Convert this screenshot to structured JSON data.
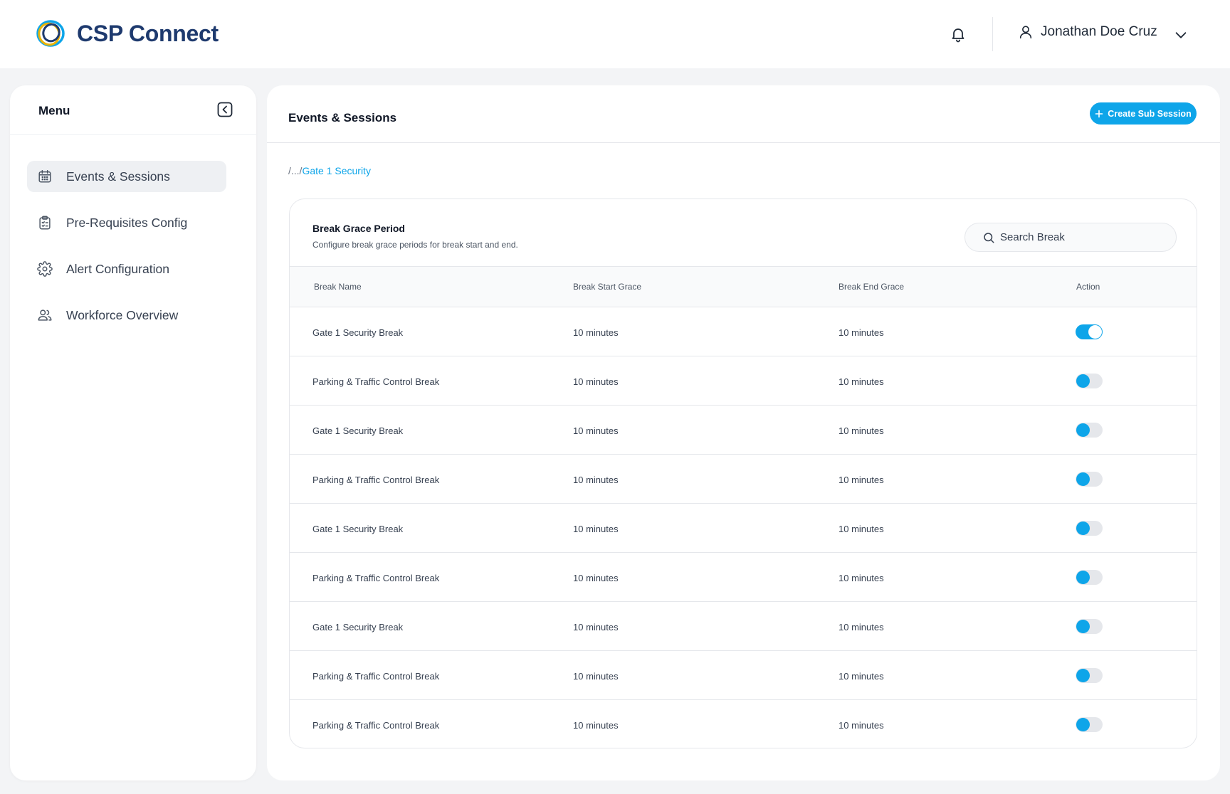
{
  "app": {
    "logo_prefix": "CSP",
    "logo_suffix": "Connect"
  },
  "header": {
    "user_name": "Jonathan Doe Cruz"
  },
  "sidebar": {
    "title": "Menu",
    "items": [
      {
        "label": "Events & Sessions",
        "icon": "calendar-icon",
        "active": true
      },
      {
        "label": "Pre-Requisites Config",
        "icon": "clipboard-icon",
        "active": false
      },
      {
        "label": "Alert Configuration",
        "icon": "gear-icon",
        "active": false
      },
      {
        "label": "Workforce Overview",
        "icon": "users-icon",
        "active": false
      }
    ]
  },
  "main": {
    "title": "Events & Sessions",
    "create_button": "Create Sub Session",
    "breadcrumb_prefix": "/.../",
    "breadcrumb_current": "Gate 1 Security"
  },
  "card": {
    "title": "Break Grace Period",
    "subtitle": "Configure break grace periods for break start and end.",
    "search_placeholder": "Search Break"
  },
  "table": {
    "columns": [
      "Break Name",
      "Break Start Grace",
      "Break End Grace",
      "Action"
    ],
    "rows": [
      {
        "name": "Gate 1 Security Break",
        "start": "10 minutes",
        "end": "10 minutes",
        "enabled": true
      },
      {
        "name": "Parking & Traffic Control Break",
        "start": "10 minutes",
        "end": "10 minutes",
        "enabled": false
      },
      {
        "name": "Gate 1 Security Break",
        "start": "10 minutes",
        "end": "10 minutes",
        "enabled": false
      },
      {
        "name": "Parking & Traffic Control Break",
        "start": "10 minutes",
        "end": "10 minutes",
        "enabled": false
      },
      {
        "name": "Gate 1 Security Break",
        "start": "10 minutes",
        "end": "10 minutes",
        "enabled": false
      },
      {
        "name": "Parking & Traffic Control Break",
        "start": "10 minutes",
        "end": "10 minutes",
        "enabled": false
      },
      {
        "name": "Gate 1 Security Break",
        "start": "10 minutes",
        "end": "10 minutes",
        "enabled": false
      },
      {
        "name": "Parking & Traffic Control Break",
        "start": "10 minutes",
        "end": "10 minutes",
        "enabled": false
      },
      {
        "name": "Parking & Traffic Control Break",
        "start": "10 minutes",
        "end": "10 minutes",
        "enabled": false
      }
    ]
  },
  "colors": {
    "accent": "#0ea5e9",
    "brand_navy": "#1e3a6e"
  }
}
